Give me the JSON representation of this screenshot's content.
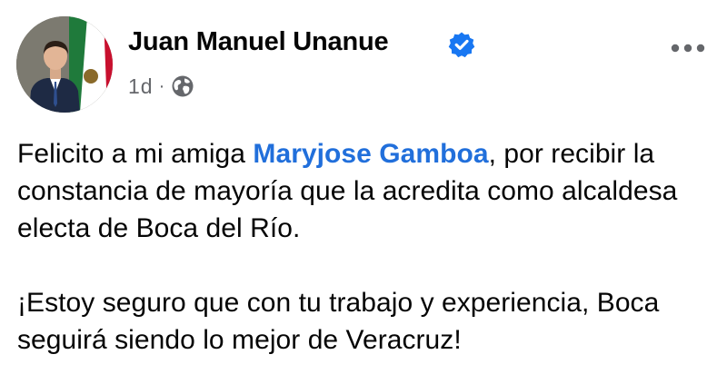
{
  "post": {
    "author": {
      "name": "Juan Manuel Unanue",
      "verified": true,
      "avatar_icon": "profile-photo-with-flag"
    },
    "meta": {
      "time": "1d",
      "separator": "·",
      "audience_icon": "globe-icon"
    },
    "more_icon": "more-options-icon",
    "body": {
      "para1_before": "Felicito a mi amiga ",
      "mention": "Maryjose Gamboa",
      "para1_after": ", por recibir la constancia de mayoría que la acredita como alcaldesa electa de Boca del Río.",
      "para2": "¡Estoy seguro que con tu trabajo y experiencia, Boca seguirá siendo lo mejor de Veracruz!"
    }
  },
  "colors": {
    "text": "#050505",
    "secondary_text": "#65676b",
    "mention": "#216fdb",
    "verified_badge": "#1877f2",
    "background": "#ffffff"
  }
}
